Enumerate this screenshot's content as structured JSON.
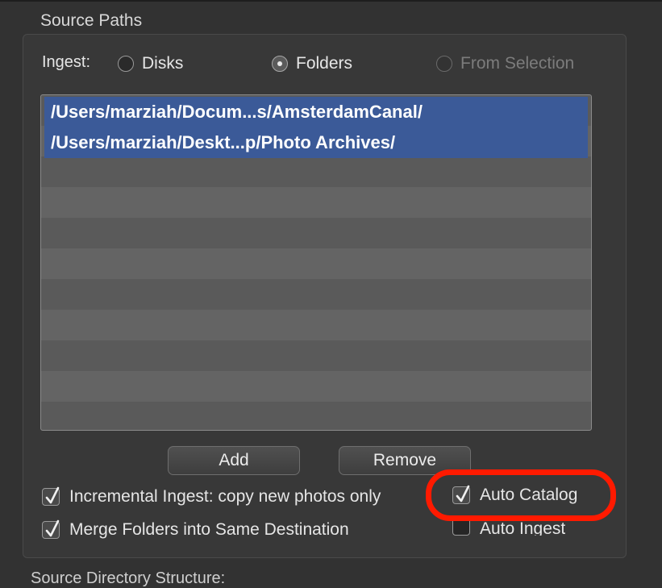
{
  "section_title": "Source Paths",
  "ingest": {
    "label": "Ingest:",
    "options": [
      {
        "label": "Disks",
        "selected": false,
        "enabled": true
      },
      {
        "label": "Folders",
        "selected": true,
        "enabled": true
      },
      {
        "label": "From Selection",
        "selected": false,
        "enabled": false
      }
    ]
  },
  "paths": [
    "/Users/marziah/Docum...s/AmsterdamCanal/",
    "/Users/marziah/Deskt...p/Photo Archives/"
  ],
  "buttons": {
    "add": "Add",
    "remove": "Remove"
  },
  "options": {
    "incremental": {
      "label": "Incremental Ingest: copy new photos only",
      "checked": true
    },
    "merge": {
      "label": "Merge Folders into Same Destination",
      "checked": true
    },
    "auto_catalog": {
      "label": "Auto Catalog",
      "checked": true
    },
    "auto_ingest": {
      "label": "Auto Ingest",
      "checked": false
    }
  },
  "next_section_title": "Source Directory Structure:",
  "colors": {
    "selection": "#3b5a98",
    "annotation": "#ff1a00"
  }
}
